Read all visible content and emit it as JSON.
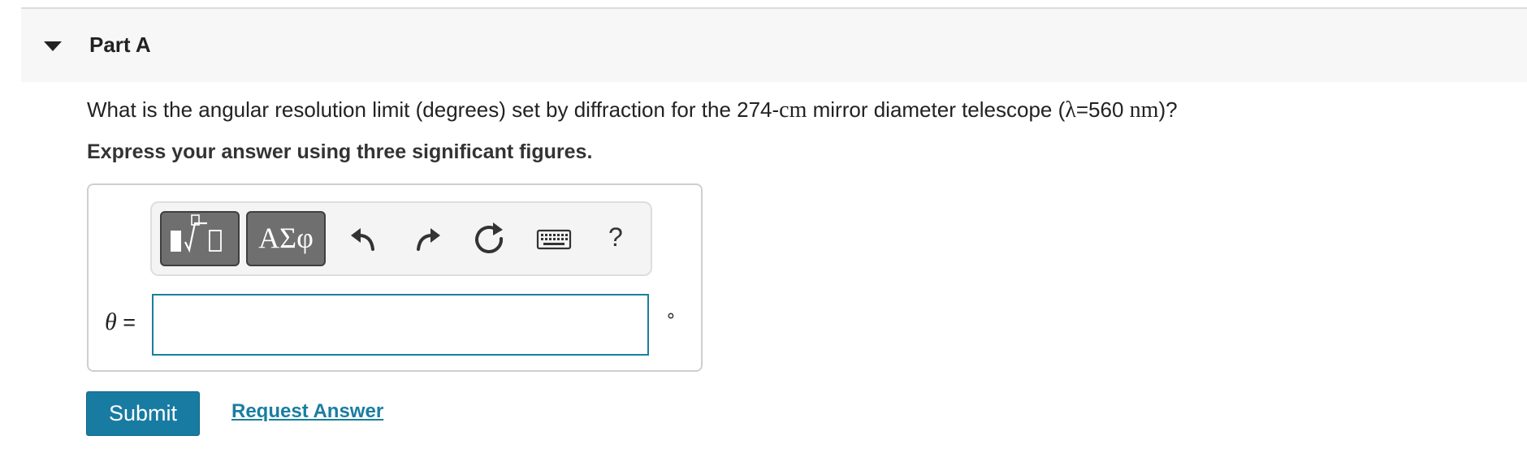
{
  "part": {
    "title": "Part A",
    "collapse_icon": "caret-down-icon"
  },
  "question": {
    "text_before": "What is the angular resolution limit (degrees) set by diffraction for the 274-",
    "length_unit": "cm",
    "text_middle": " mirror diameter telescope (",
    "lambda_symbol": "λ",
    "lambda_value": "=560 ",
    "wavelength_unit": "nm",
    "text_end": ")?"
  },
  "instruction": "Express your answer using three significant figures.",
  "toolbar": {
    "templates_icon": "templates-sqrt-icon",
    "greek_label": "ΑΣφ",
    "undo_icon": "undo-icon",
    "redo_icon": "redo-icon",
    "reset_icon": "reset-icon",
    "keyboard_icon": "keyboard-icon",
    "help_label": "?"
  },
  "answer": {
    "variable": "θ",
    "equals": " =",
    "value": "",
    "unit": "∘"
  },
  "actions": {
    "submit_label": "Submit",
    "request_label": "Request Answer"
  }
}
